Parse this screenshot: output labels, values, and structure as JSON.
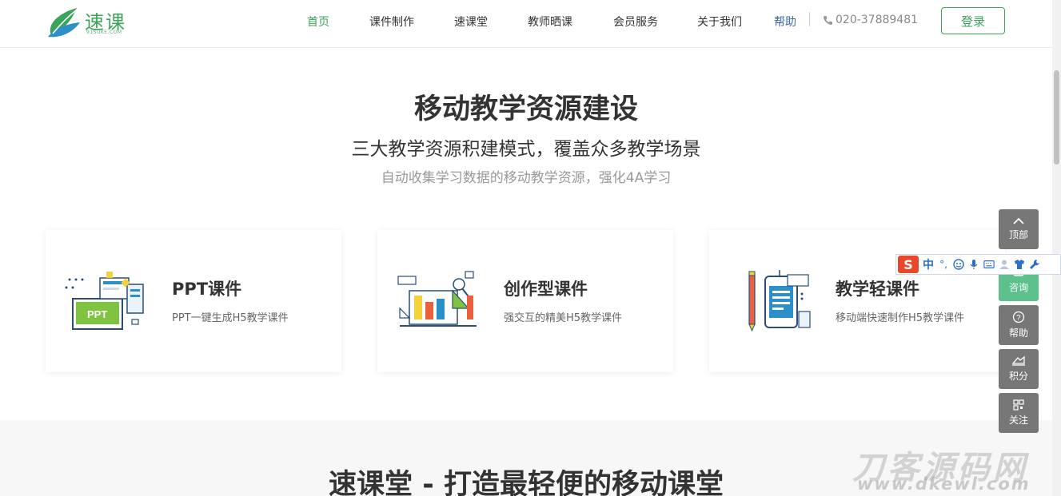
{
  "header": {
    "logo_name": "速课",
    "logo_sub": "91SUKE.COM",
    "nav": [
      "首页",
      "课件制作",
      "速课堂",
      "教师晒课",
      "会员服务",
      "关于我们",
      "帮助"
    ],
    "phone": "020-37889481",
    "login": "登录"
  },
  "section1": {
    "title": "移动教学资源建设",
    "subtitle": "三大教学资源积建模式，覆盖众多教学场景",
    "subtitle2": "自动收集学习数据的移动教学资源，强化4A学习",
    "cards": [
      {
        "title": "PPT课件",
        "desc": "PPT一键生成H5教学课件",
        "badge": "PPT"
      },
      {
        "title": "创作型课件",
        "desc": "强交互的精美H5教学课件"
      },
      {
        "title": "教学轻课件",
        "desc": "移动端快速制作H5教学课件"
      }
    ]
  },
  "section2": {
    "title": "速课堂 - 打造最轻便的移动课堂"
  },
  "side": [
    "顶部",
    "咨询",
    "帮助",
    "积分",
    "关注"
  ],
  "ime": {
    "logo": "S",
    "lang": "中",
    "punct": "°,"
  },
  "watermark": {
    "line1": "刀客源码网",
    "line2": "www.dkewl.com"
  },
  "colors": {
    "brand_green": "#3aa55a",
    "side_gray": "#777777",
    "side_green": "#5cc18a"
  }
}
